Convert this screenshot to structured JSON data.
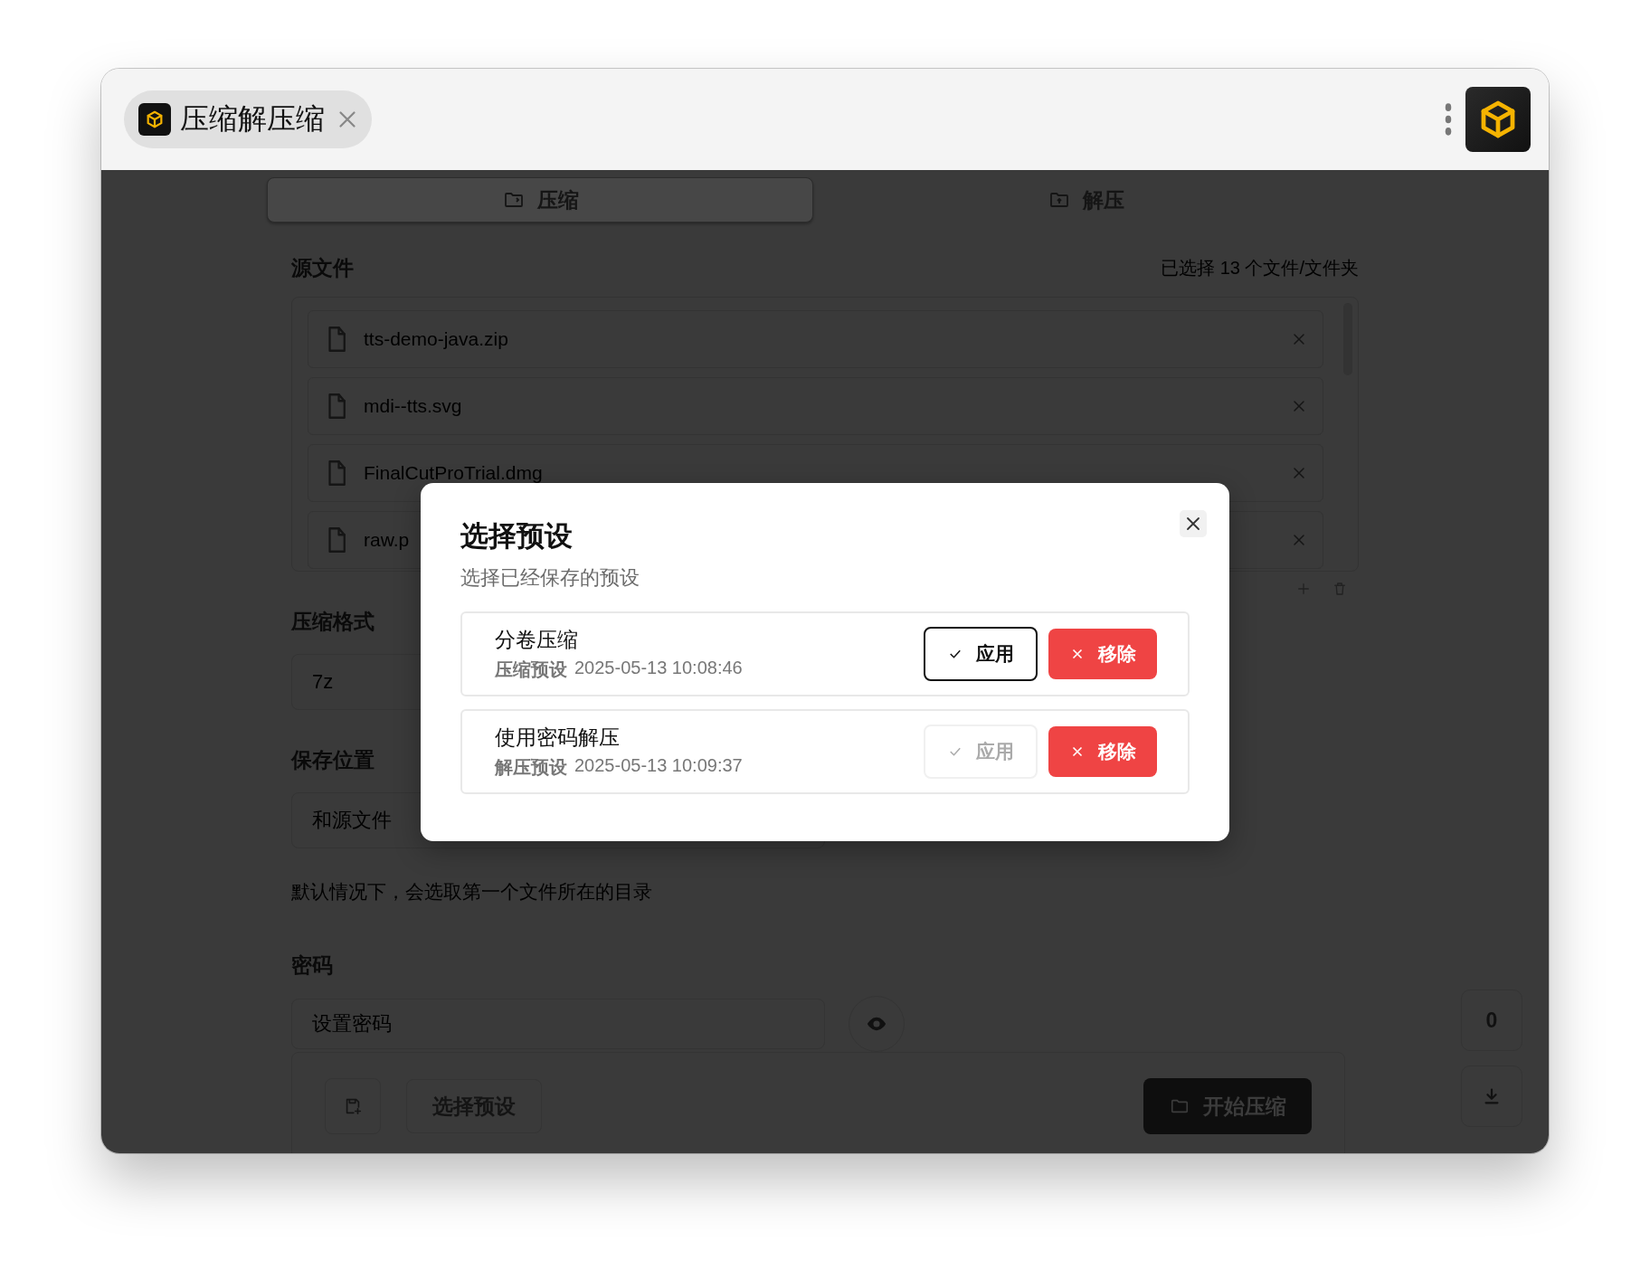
{
  "titlebar": {
    "tab_title": "压缩解压缩"
  },
  "mode_tabs": [
    {
      "label": "压缩",
      "selected": true
    },
    {
      "label": "解压",
      "selected": false
    }
  ],
  "source": {
    "label": "源文件",
    "count": "已选择 13 个文件/文件夹",
    "files": [
      "tts-demo-java.zip",
      "mdi--tts.svg",
      "FinalCutProTrial.dmg",
      "raw.p"
    ]
  },
  "format": {
    "label": "压缩格式",
    "value": "7z"
  },
  "location": {
    "label": "保存位置",
    "value": "和源文件",
    "hint": "默认情况下，会选取第一个文件所在的目录"
  },
  "password": {
    "label": "密码",
    "placeholder": "设置密码"
  },
  "actions": {
    "preset_button": "选择预设",
    "start_button": "开始压缩"
  },
  "side": {
    "counter": "0"
  },
  "dialog": {
    "title": "选择预设",
    "subtitle": "选择已经保存的预设",
    "presets": [
      {
        "name": "分卷压缩",
        "type": "压缩预设",
        "time": "2025-05-13 10:08:46",
        "apply_label": "应用",
        "remove_label": "移除",
        "apply_focused": true,
        "apply_disabled": false
      },
      {
        "name": "使用密码解压",
        "type": "解压预设",
        "time": "2025-05-13 10:09:37",
        "apply_label": "应用",
        "remove_label": "移除",
        "apply_focused": false,
        "apply_disabled": true
      }
    ]
  }
}
